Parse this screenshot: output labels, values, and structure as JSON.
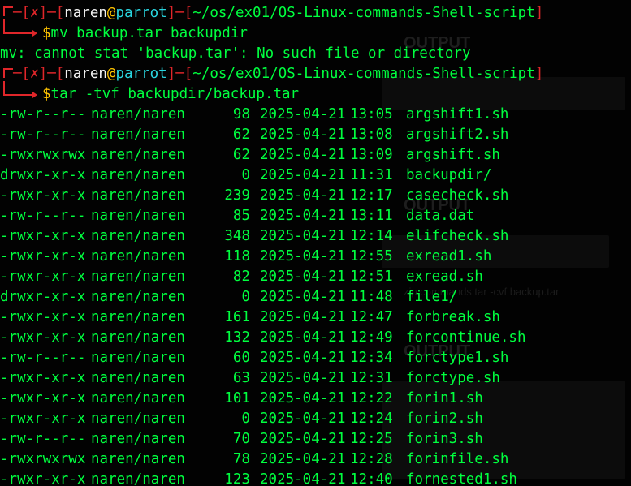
{
  "colors": {
    "background": "#020202",
    "prompt_bracket": "#e0262a",
    "user": "#f2f2f2",
    "host": "#2ad6e0",
    "path": "#e0262a",
    "dollar": "#ffc400",
    "output": "#00ff3f"
  },
  "prompt1": {
    "status_icon": "✗",
    "user": "naren",
    "at": "@",
    "host": "parrot",
    "path": "~/os/ex01/OS-Linux-commands-Shell-script",
    "dollar": "$",
    "command": "mv backup.tar backupdir"
  },
  "error_line": "mv: cannot stat 'backup.tar': No such file or directory",
  "prompt2": {
    "status_icon": "✗",
    "user": "naren",
    "at": "@",
    "host": "parrot",
    "path": "~/os/ex01/OS-Linux-commands-Shell-script",
    "dollar": "$",
    "command": "tar -tvf backupdir/backup.tar"
  },
  "listing": [
    {
      "perm": "-rw-r--r--",
      "owner": "naren/naren",
      "size": "98",
      "date": "2025-04-21",
      "time": "13:05",
      "name": "argshift1.sh"
    },
    {
      "perm": "-rw-r--r--",
      "owner": "naren/naren",
      "size": "62",
      "date": "2025-04-21",
      "time": "13:08",
      "name": "argshift2.sh"
    },
    {
      "perm": "-rwxrwxrwx",
      "owner": "naren/naren",
      "size": "62",
      "date": "2025-04-21",
      "time": "13:09",
      "name": "argshift.sh"
    },
    {
      "perm": "drwxr-xr-x",
      "owner": "naren/naren",
      "size": "0",
      "date": "2025-04-21",
      "time": "11:31",
      "name": "backupdir/"
    },
    {
      "perm": "-rwxr-xr-x",
      "owner": "naren/naren",
      "size": "239",
      "date": "2025-04-21",
      "time": "12:17",
      "name": "casecheck.sh"
    },
    {
      "perm": "-rw-r--r--",
      "owner": "naren/naren",
      "size": "85",
      "date": "2025-04-21",
      "time": "13:11",
      "name": "data.dat"
    },
    {
      "perm": "-rwxr-xr-x",
      "owner": "naren/naren",
      "size": "348",
      "date": "2025-04-21",
      "time": "12:14",
      "name": "elifcheck.sh"
    },
    {
      "perm": "-rwxr-xr-x",
      "owner": "naren/naren",
      "size": "118",
      "date": "2025-04-21",
      "time": "12:55",
      "name": "exread1.sh"
    },
    {
      "perm": "-rwxr-xr-x",
      "owner": "naren/naren",
      "size": "82",
      "date": "2025-04-21",
      "time": "12:51",
      "name": "exread.sh"
    },
    {
      "perm": "drwxr-xr-x",
      "owner": "naren/naren",
      "size": "0",
      "date": "2025-04-21",
      "time": "11:48",
      "name": "file1/"
    },
    {
      "perm": "-rwxr-xr-x",
      "owner": "naren/naren",
      "size": "161",
      "date": "2025-04-21",
      "time": "12:47",
      "name": "forbreak.sh"
    },
    {
      "perm": "-rwxr-xr-x",
      "owner": "naren/naren",
      "size": "132",
      "date": "2025-04-21",
      "time": "12:49",
      "name": "forcontinue.sh"
    },
    {
      "perm": "-rw-r--r--",
      "owner": "naren/naren",
      "size": "60",
      "date": "2025-04-21",
      "time": "12:34",
      "name": "forctype1.sh"
    },
    {
      "perm": "-rwxr-xr-x",
      "owner": "naren/naren",
      "size": "63",
      "date": "2025-04-21",
      "time": "12:31",
      "name": "forctype.sh"
    },
    {
      "perm": "-rwxr-xr-x",
      "owner": "naren/naren",
      "size": "101",
      "date": "2025-04-21",
      "time": "12:22",
      "name": "forin1.sh"
    },
    {
      "perm": "-rwxr-xr-x",
      "owner": "naren/naren",
      "size": "0",
      "date": "2025-04-21",
      "time": "12:24",
      "name": "forin2.sh"
    },
    {
      "perm": "-rw-r--r--",
      "owner": "naren/naren",
      "size": "70",
      "date": "2025-04-21",
      "time": "12:25",
      "name": "forin3.sh"
    },
    {
      "perm": "-rwxrwxrwx",
      "owner": "naren/naren",
      "size": "78",
      "date": "2025-04-21",
      "time": "12:28",
      "name": "forinfile.sh"
    },
    {
      "perm": "-rwxr-xr-x",
      "owner": "naren/naren",
      "size": "123",
      "date": "2025-04-21",
      "time": "12:40",
      "name": "fornested1.sh"
    }
  ]
}
